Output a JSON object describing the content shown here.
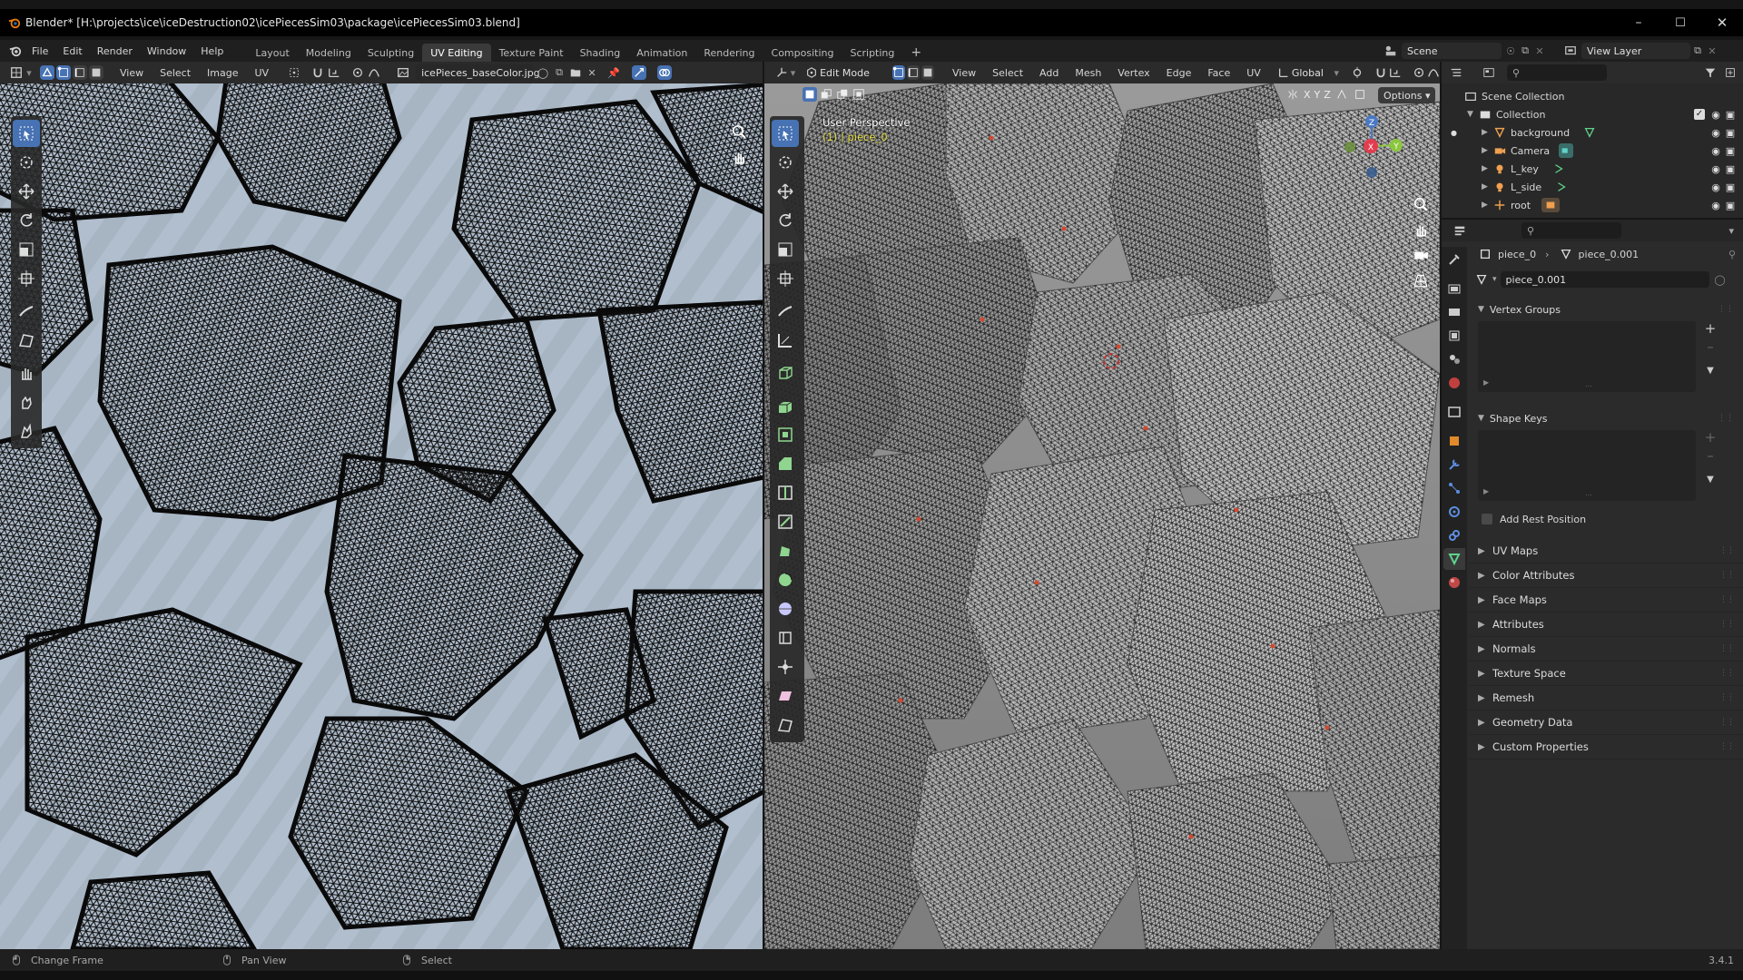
{
  "window": {
    "title": "Blender* [H:\\projects\\ice\\iceDestruction02\\icePiecesSim03\\package\\icePiecesSim03.blend]"
  },
  "menubar": {
    "menus": [
      "File",
      "Edit",
      "Render",
      "Window",
      "Help"
    ],
    "workspaces": [
      "Layout",
      "Modeling",
      "Sculpting",
      "UV Editing",
      "Texture Paint",
      "Shading",
      "Animation",
      "Rendering",
      "Compositing",
      "Scripting"
    ],
    "add_tab": "+",
    "scene": "Scene",
    "view_layer": "View Layer"
  },
  "uv_editor": {
    "menus": [
      "View",
      "Select",
      "Image",
      "UV"
    ],
    "image_name": "icePieces_baseColor.jpg"
  },
  "viewport": {
    "mode": "Edit Mode",
    "menus": [
      "View",
      "Select",
      "Add",
      "Mesh",
      "Vertex",
      "Edge",
      "Face",
      "UV"
    ],
    "orientation": "Global",
    "axis_labels": [
      "X",
      "Y",
      "Z"
    ],
    "options_label": "Options",
    "overlay_line1": "User Perspective",
    "overlay_line2": "(1) | piece_0",
    "gizmo": {
      "x": "X",
      "y": "Y",
      "z": "Z"
    }
  },
  "outliner": {
    "root": "Scene Collection",
    "collection": "Collection",
    "items": [
      {
        "label": "background"
      },
      {
        "label": "Camera"
      },
      {
        "label": "L_key"
      },
      {
        "label": "L_side"
      },
      {
        "label": "root"
      }
    ]
  },
  "properties": {
    "breadcrumb_object": "piece_0",
    "breadcrumb_data": "piece_0.001",
    "data_name": "piece_0.001",
    "vertex_groups": "Vertex Groups",
    "shape_keys": "Shape Keys",
    "add_rest_position": "Add Rest Position",
    "sections": [
      "UV Maps",
      "Color Attributes",
      "Face Maps",
      "Attributes",
      "Normals",
      "Texture Space",
      "Remesh",
      "Geometry Data",
      "Custom Properties"
    ]
  },
  "statusbar": {
    "items": [
      "Change Frame",
      "Pan View",
      "Select"
    ],
    "version": "3.4.1"
  },
  "colors": {
    "accent": "#4772b3",
    "uv_bg": "#a9b6c4",
    "viewport_bg": "#8f8f8f"
  }
}
